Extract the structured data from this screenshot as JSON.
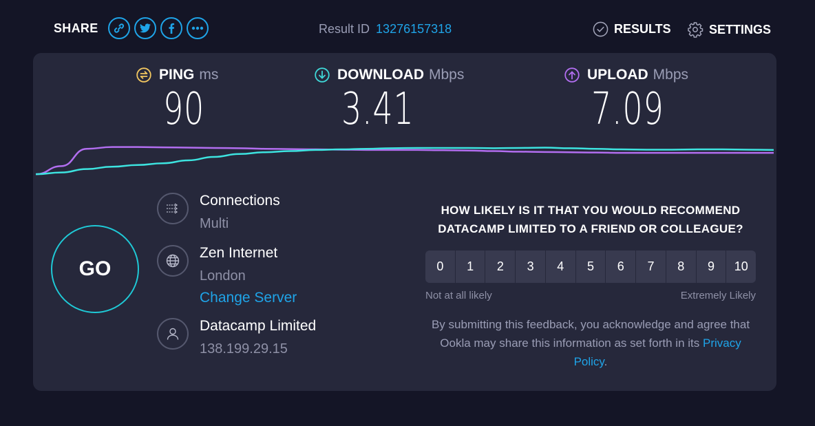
{
  "header": {
    "share_label": "SHARE",
    "share_buttons": [
      {
        "icon": "link-icon"
      },
      {
        "icon": "twitter-icon"
      },
      {
        "icon": "facebook-icon"
      },
      {
        "icon": "more-icon"
      }
    ],
    "result_id_label": "Result ID",
    "result_id": "13276157318",
    "results_label": "RESULTS",
    "settings_label": "SETTINGS"
  },
  "metrics": {
    "ping": {
      "label": "PING",
      "unit": "ms",
      "value": "90",
      "color": "#f4c860"
    },
    "download": {
      "label": "DOWNLOAD",
      "unit": "Mbps",
      "value": "3.41",
      "color": "#3fd8d8"
    },
    "upload": {
      "label": "UPLOAD",
      "unit": "Mbps",
      "value": "7.09",
      "color": "#b26ef0"
    }
  },
  "graph": {
    "download_color": "#3de4e0",
    "upload_color": "#b26ef0",
    "download_series": [
      0.02,
      0.08,
      0.2,
      0.28,
      0.34,
      0.4,
      0.5,
      0.62,
      0.72,
      0.78,
      0.82,
      0.86,
      0.88,
      0.9,
      0.92,
      0.93,
      0.93,
      0.93,
      0.92,
      0.93,
      0.94,
      0.92,
      0.9,
      0.88,
      0.87,
      0.87,
      0.88,
      0.88,
      0.87,
      0.86
    ],
    "upload_series": [
      0.02,
      0.3,
      0.9,
      0.96,
      0.96,
      0.95,
      0.94,
      0.93,
      0.92,
      0.9,
      0.89,
      0.88,
      0.87,
      0.86,
      0.86,
      0.86,
      0.85,
      0.84,
      0.82,
      0.8,
      0.79,
      0.78,
      0.77,
      0.76,
      0.76,
      0.76,
      0.76,
      0.76,
      0.76,
      0.76
    ]
  },
  "go_label": "GO",
  "connections": {
    "title": "Connections",
    "value": "Multi"
  },
  "server": {
    "name": "Zen Internet",
    "location": "London",
    "change_label": "Change Server"
  },
  "isp": {
    "name": "Datacamp Limited",
    "ip": "138.199.29.15"
  },
  "survey": {
    "question": "HOW LIKELY IS IT THAT YOU WOULD RECOMMEND DATACAMP LIMITED TO A FRIEND OR COLLEAGUE?",
    "scale": [
      "0",
      "1",
      "2",
      "3",
      "4",
      "5",
      "6",
      "7",
      "8",
      "9",
      "10"
    ],
    "low_label": "Not at all likely",
    "high_label": "Extremely Likely",
    "disclaimer": "By submitting this feedback, you acknowledge and agree that Ookla may share this information as set forth in its",
    "privacy_link": "Privacy Policy",
    "disclaimer_end": "."
  },
  "colors": {
    "accent": "#1fa4e8",
    "background": "#141526",
    "panel": "#26283b"
  }
}
